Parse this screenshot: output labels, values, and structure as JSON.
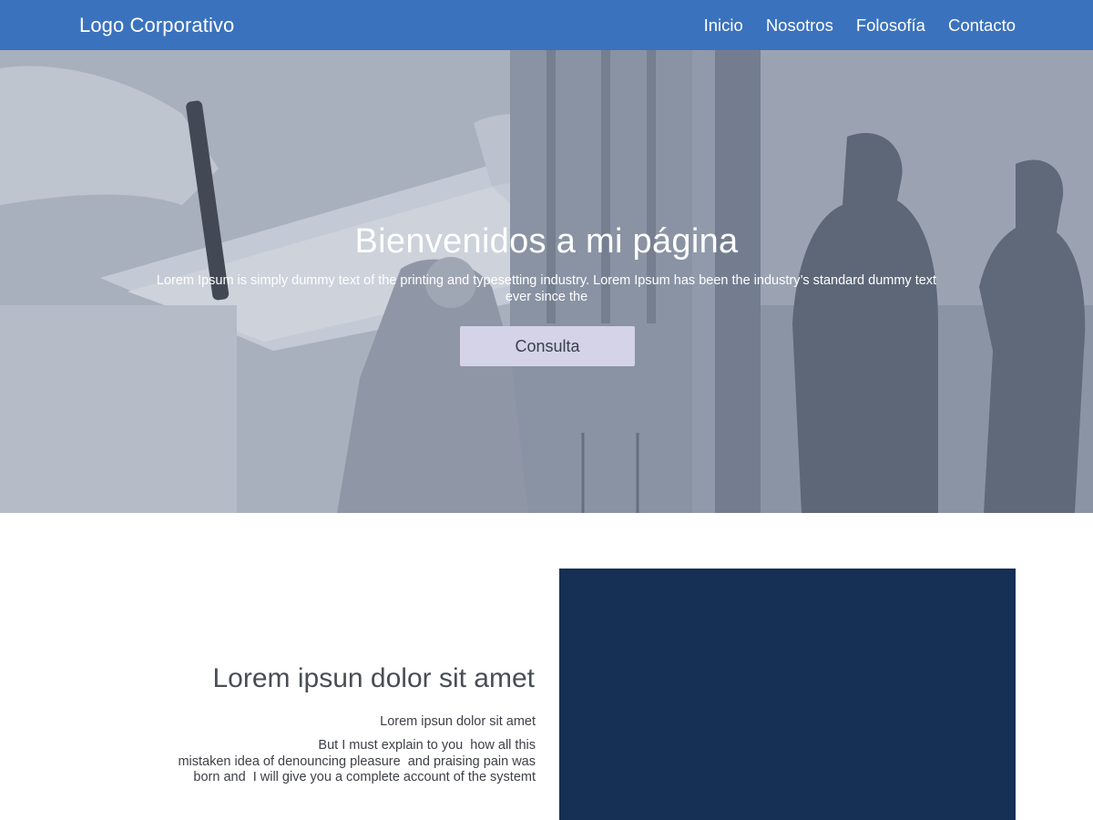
{
  "header": {
    "logo": "Logo Corporativo",
    "nav": [
      "Inicio",
      "Nosotros",
      "Folosofía",
      "Contacto"
    ]
  },
  "hero": {
    "title": "Bienvenidos a mi página",
    "subtitle": "Lorem Ipsum is simply dummy text of the printing and typesetting industry. Lorem Ipsum has been the industry’s standard dummy text ever since the",
    "button": "Consulta"
  },
  "section": {
    "title": "Lorem ipsun dolor sit amet",
    "subtitle": "Lorem ipsun dolor sit amet",
    "body_lines": [
      "But I must explain to you  how all this",
      "mistaken idea of denouncing pleasure  and praising pain was",
      "born and  I will give you a complete account of the systemt"
    ]
  },
  "colors": {
    "header_bg": "#3a72bd",
    "button_bg": "#d4d3e7",
    "block_bg": "#162f55"
  }
}
